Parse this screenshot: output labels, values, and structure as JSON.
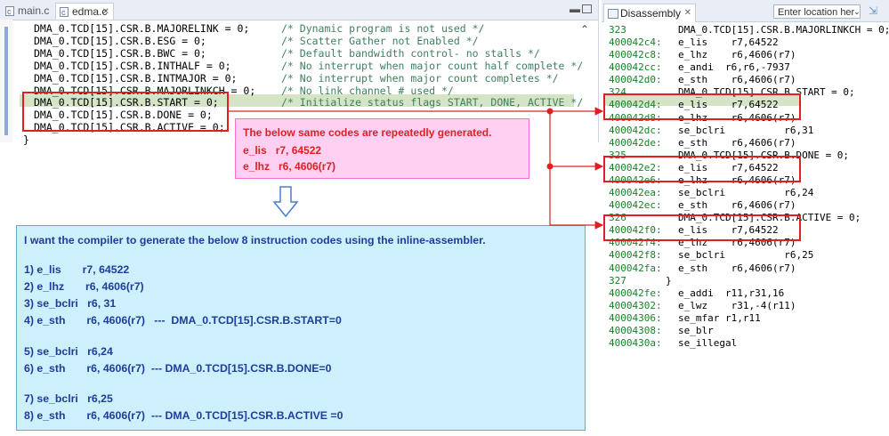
{
  "editor": {
    "tabs": [
      {
        "label": "main.c"
      },
      {
        "label": "edma.c"
      }
    ],
    "lines": [
      {
        "code": "DMA_0.TCD[15].CSR.B.MAJORELINK = 0;",
        "comment": "/* Dynamic program is not used */"
      },
      {
        "code": "DMA_0.TCD[15].CSR.B.ESG = 0;",
        "comment": "/* Scatter Gather not Enabled */"
      },
      {
        "code": "DMA_0.TCD[15].CSR.B.BWC = 0;",
        "comment": "/* Default bandwidth control- no stalls */"
      },
      {
        "code": "DMA_0.TCD[15].CSR.B.INTHALF = 0;",
        "comment": "/* No interrupt when major count half complete */"
      },
      {
        "code": "DMA_0.TCD[15].CSR.B.INTMAJOR = 0;",
        "comment": "/* No interrupt when major count completes */"
      },
      {
        "code": "DMA_0.TCD[15].CSR.B.MAJORLINKCH = 0;",
        "comment": "/* No link channel # used */"
      },
      {
        "code": "DMA_0.TCD[15].CSR.B.START = 0;",
        "comment": "/* Initialize status flags START, DONE, ACTIVE */"
      },
      {
        "code": "DMA_0.TCD[15].CSR.B.DONE = 0;",
        "comment": ""
      },
      {
        "code": "DMA_0.TCD[15].CSR.B.ACTIVE = 0;",
        "comment": ""
      },
      {
        "code": "}",
        "comment": ""
      }
    ]
  },
  "note": {
    "title": "The below same codes are repeatedly generated.",
    "line1": "e_lis   r7, 64522",
    "line2": "e_lhz   r6, 4606(r7)"
  },
  "request": {
    "intro": "I want the compiler to generate the below 8 instruction codes using the inline-assembler.",
    "lines": [
      "1) e_lis       r7, 64522",
      "2) e_lhz       r6, 4606(r7)",
      "3) se_bclri   r6, 31",
      "4) e_sth       r6, 4606(r7)   ---  DMA_0.TCD[15].CSR.B.START=0",
      "5) se_bclri   r6,24",
      "6) e_sth       r6, 4606(r7)  --- DMA_0.TCD[15].CSR.B.DONE=0",
      "7) se_bclri   r6,25",
      "8) e_sth       r6, 4606(r7)  --- DMA_0.TCD[15].CSR.B.ACTIVE =0"
    ]
  },
  "disassembly": {
    "tab_label": "Disassembly",
    "location_placeholder": "Enter location her",
    "lines": [
      {
        "addr": "323",
        "text": "DMA_0.TCD[15].CSR.B.MAJORLINKCH = 0;"
      },
      {
        "addr": "400042c4:",
        "text": "e_lis    r7,64522"
      },
      {
        "addr": "400042c8:",
        "text": "e_lhz    r6,4606(r7)"
      },
      {
        "addr": "400042cc:",
        "text": "e_andi  r6,r6,-7937"
      },
      {
        "addr": "400042d0:",
        "text": "e_sth    r6,4606(r7)"
      },
      {
        "addr": "324",
        "text": "DMA_0.TCD[15].CSR.B.START = 0;"
      },
      {
        "addr": "400042d4:",
        "text": "e_lis    r7,64522"
      },
      {
        "addr": "400042d8:",
        "text": "e_lhz    r6,4606(r7)"
      },
      {
        "addr": "400042dc:",
        "text": "se_bclri          r6,31"
      },
      {
        "addr": "400042de:",
        "text": "e_sth    r6,4606(r7)"
      },
      {
        "addr": "325",
        "text": "DMA_0.TCD[15].CSR.B.DONE = 0;"
      },
      {
        "addr": "400042e2:",
        "text": "e_lis    r7,64522"
      },
      {
        "addr": "400042e6:",
        "text": "e_lhz    r6,4606(r7)"
      },
      {
        "addr": "400042ea:",
        "text": "se_bclri          r6,24"
      },
      {
        "addr": "400042ec:",
        "text": "e_sth    r6,4606(r7)"
      },
      {
        "addr": "326",
        "text": "DMA_0.TCD[15].CSR.B.ACTIVE = 0;"
      },
      {
        "addr": "400042f0:",
        "text": "e_lis    r7,64522"
      },
      {
        "addr": "400042f4:",
        "text": "e_lhz    r6,4606(r7)"
      },
      {
        "addr": "400042f8:",
        "text": "se_bclri          r6,25"
      },
      {
        "addr": "400042fa:",
        "text": "e_sth    r6,4606(r7)"
      },
      {
        "addr": "327",
        "text": "}"
      },
      {
        "addr": "400042fe:",
        "text": "e_addi  r11,r31,16"
      },
      {
        "addr": "40004302:",
        "text": "e_lwz    r31,-4(r11)"
      },
      {
        "addr": "40004306:",
        "text": "se_mfar r1,r11"
      },
      {
        "addr": "40004308:",
        "text": "se_blr"
      },
      {
        "addr": "4000430a:",
        "text": "se_illegal"
      }
    ]
  },
  "colors": {
    "annotation_red": "#e02020",
    "note_bg": "#ffd0f2",
    "request_bg": "#cdf0fc",
    "request_text": "#1f3d9a",
    "current_line": "#d4e4c4"
  }
}
